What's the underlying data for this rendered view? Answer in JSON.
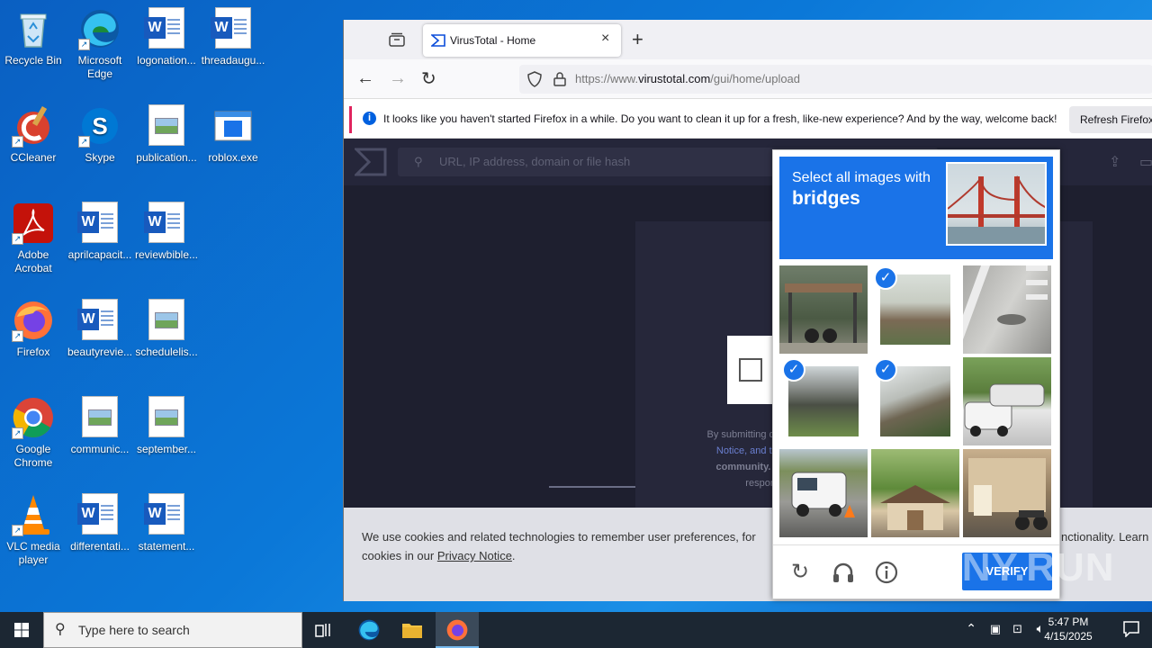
{
  "desktop": {
    "icons": [
      {
        "label": "Recycle Bin"
      },
      {
        "label": "Microsoft Edge"
      },
      {
        "label": "logonation..."
      },
      {
        "label": "threadaugu..."
      },
      {
        "label": "CCleaner"
      },
      {
        "label": "Skype"
      },
      {
        "label": "publication..."
      },
      {
        "label": "roblox.exe"
      },
      {
        "label": "Adobe Acrobat"
      },
      {
        "label": "aprilcapacit..."
      },
      {
        "label": "reviewbible..."
      },
      {
        "label": "Firefox"
      },
      {
        "label": "beautyrevie..."
      },
      {
        "label": "schedulelis..."
      },
      {
        "label": "Google Chrome"
      },
      {
        "label": "communic..."
      },
      {
        "label": "september..."
      },
      {
        "label": "VLC media player"
      },
      {
        "label": "differentati..."
      },
      {
        "label": "statement..."
      }
    ]
  },
  "browser": {
    "tab_title": "VirusTotal - Home",
    "url_prefix": "https://www.",
    "url_domain": "virustotal.com",
    "url_path": "/gui/home/upload",
    "notice_text": "It looks like you haven't started Firefox in a while. Do you want to clean it up for a fresh, like-new experience? And by the way, welcome back!",
    "notice_button": "Refresh Firefox..."
  },
  "page": {
    "search_placeholder": "URL, IP address, domain or file hash",
    "submit_text_1": "By submitting data",
    "submit_text_2": "Notice, and to th",
    "submit_text_3": "community. Ple",
    "submit_text_4": "responsib",
    "cookie_text_1": "We use cookies and related technologies to remember user preferences, for",
    "cookie_text_2": "cookies in our",
    "cookie_link": "Privacy Notice",
    "cookie_text_end": "nctionality. Learn",
    "cookie_period": "."
  },
  "captcha": {
    "instruction": "Select all images with",
    "target": "bridges",
    "tiles_selected": [
      false,
      true,
      false,
      true,
      true,
      false,
      false,
      false,
      false
    ],
    "verify_label": "VERIFY"
  },
  "taskbar": {
    "search_placeholder": "Type here to search",
    "time": "5:47 PM",
    "date": "4/15/2025"
  },
  "watermark": "ANY.RUN",
  "colors": {
    "captcha_blue": "#1a73e8",
    "desktop_blue": "#0b78d8",
    "taskbar": "#1c2733"
  }
}
